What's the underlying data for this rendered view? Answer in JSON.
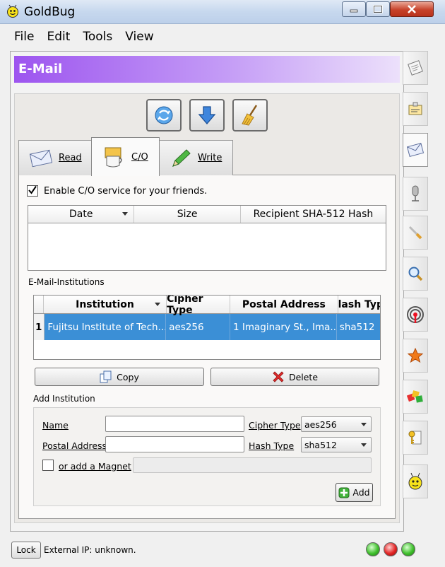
{
  "window": {
    "title": "GoldBug"
  },
  "menu": [
    "File",
    "Edit",
    "Tools",
    "View"
  ],
  "header": {
    "title": "E-Mail"
  },
  "tabs": [
    {
      "label": "Read",
      "icon": "envelope-icon"
    },
    {
      "label": "C/O",
      "icon": "coffee-cup-icon",
      "active": true
    },
    {
      "label": "Write",
      "icon": "pencil-icon"
    }
  ],
  "co": {
    "enable_label": "Enable C/O service for your friends.",
    "enabled": true,
    "columns": [
      "Date",
      "Size",
      "Recipient SHA-512 Hash"
    ]
  },
  "institutions": {
    "label": "E-Mail-Institutions",
    "columns": [
      "Institution",
      "Cipher Type",
      "Postal Address",
      "lash Typ"
    ],
    "rows": [
      {
        "num": "1",
        "institution": "Fujitsu Institute of Tech...",
        "cipher": "aes256",
        "address": "1 Imaginary St., Ima...",
        "hash": "sha512"
      }
    ],
    "copy_label": "Copy",
    "delete_label": "Delete"
  },
  "add_institution": {
    "label": "Add Institution",
    "name_label": "Name",
    "name_value": "",
    "postal_label": "Postal Address",
    "postal_value": "",
    "cipher_label": "Cipher Type",
    "cipher_value": "aes256",
    "hash_label": "Hash Type",
    "hash_value": "sha512",
    "magnet_label": "or add a Magnet",
    "magnet_value": "",
    "add_label": "Add"
  },
  "status": {
    "lock_label": "Lock",
    "external_ip": "External IP: unknown."
  },
  "colors": {
    "header_accent": "#9d55ef",
    "selection": "#3b8fd6"
  }
}
